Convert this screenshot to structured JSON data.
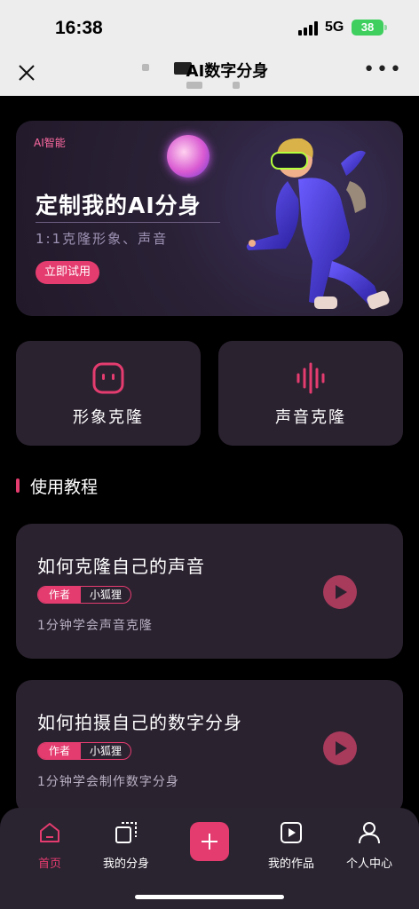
{
  "status": {
    "time": "16:38",
    "network": "5G",
    "battery": "38"
  },
  "navbar": {
    "title": "AI数字分身"
  },
  "banner": {
    "tag": "AI智能",
    "title": "定制我的AI分身",
    "subtitle": "1:1克隆形象、声音",
    "button": "立即试用"
  },
  "clone": [
    {
      "label": "形象克隆",
      "icon": "face-icon"
    },
    {
      "label": "声音克隆",
      "icon": "soundwave-icon"
    }
  ],
  "section": {
    "title": "使用教程"
  },
  "tutorials": [
    {
      "title": "如何克隆自己的声音",
      "author_key": "作者",
      "author": "小狐狸",
      "desc": "1分钟学会声音克隆"
    },
    {
      "title": "如何拍摄自己的数字分身",
      "author_key": "作者",
      "author": "小狐狸",
      "desc": "1分钟学会制作数字分身"
    }
  ],
  "tabs": [
    {
      "label": "首页",
      "icon": "home-icon",
      "active": true
    },
    {
      "label": "我的分身",
      "icon": "avatar-frame-icon"
    },
    {
      "label": "",
      "icon": "plus-icon"
    },
    {
      "label": "我的作品",
      "icon": "play-box-icon"
    },
    {
      "label": "个人中心",
      "icon": "user-icon"
    }
  ],
  "colors": {
    "accent": "#e43c6f",
    "card": "#2b2230",
    "background": "#000000"
  }
}
